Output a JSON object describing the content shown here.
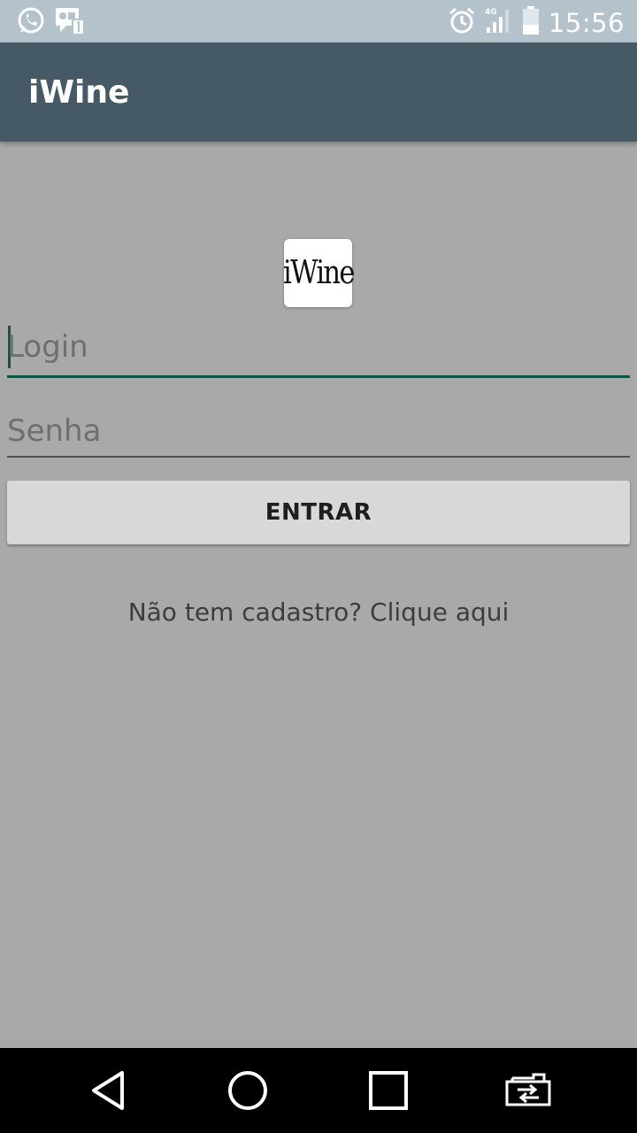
{
  "status_bar": {
    "time": "15:56",
    "network_label": "4G",
    "left_icons": [
      "whatsapp-icon",
      "notification-icon"
    ],
    "right_icons": [
      "alarm-icon",
      "signal-icon",
      "battery-icon"
    ]
  },
  "app_bar": {
    "title": "iWine"
  },
  "logo": {
    "text": "iWine"
  },
  "form": {
    "login_placeholder": "Login",
    "password_placeholder": "Senha",
    "submit_label": "ENTRAR",
    "signup_text": "Não tem cadastro? Clique aqui"
  },
  "nav_bar": {
    "icons": [
      "back-icon",
      "home-icon",
      "recents-icon",
      "switch-app-icon"
    ]
  },
  "colors": {
    "app_bar": "#465a66",
    "status_bar": "#b4c2cb",
    "accent": "#0e5546",
    "background": "#a9a9a9",
    "button": "#d7d8d8"
  }
}
